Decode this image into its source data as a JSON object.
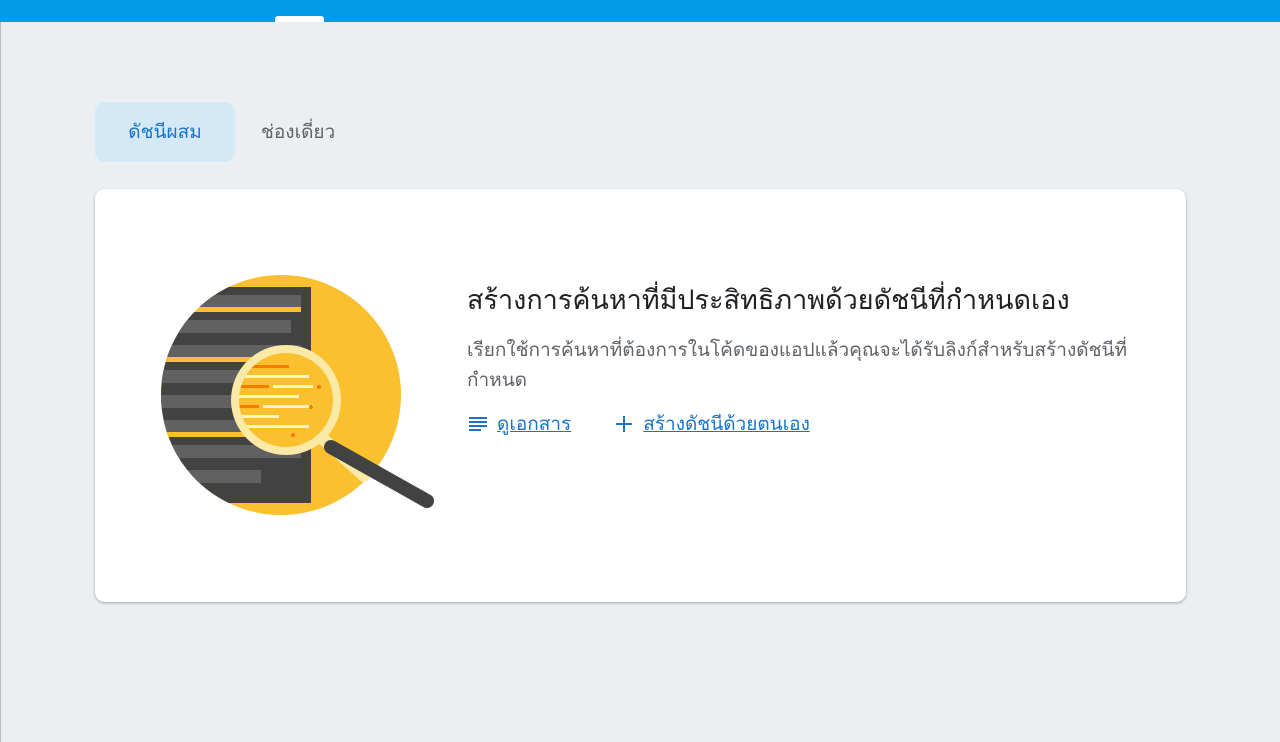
{
  "tabs": [
    {
      "label": "ดัชนีผสม",
      "active": true
    },
    {
      "label": "ช่องเดี่ยว",
      "active": false
    }
  ],
  "card": {
    "title": "สร้างการค้นหาที่มีประสิทธิภาพด้วยดัชนีที่กำหนดเอง",
    "description": "เรียกใช้การค้นหาที่ต้องการในโค้ดของแอปแล้วคุณจะได้รับลิงก์สำหรับสร้างดัชนีที่กำหนด",
    "links": {
      "docs_label": "ดูเอกสาร",
      "docs_icon": "notes-icon",
      "create_label": "สร้างดัชนีด้วยตนเอง",
      "create_icon": "plus-icon"
    },
    "illustration": "magnifier-over-document"
  },
  "colors": {
    "top_bar": "#039be5",
    "accent": "#1a73c8",
    "active_tab_bg": "#d4e8f5",
    "illustration_yellow": "#fbc02d"
  }
}
